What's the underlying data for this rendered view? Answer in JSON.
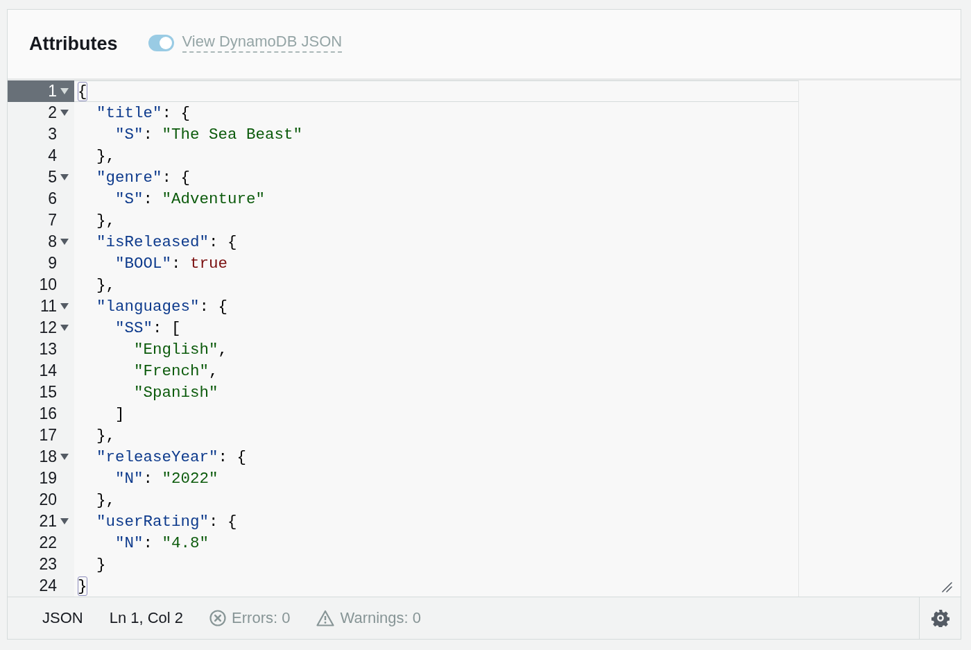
{
  "header": {
    "title": "Attributes",
    "toggle": {
      "label": "View DynamoDB JSON",
      "on": true,
      "disabled": true
    }
  },
  "editor": {
    "lines": [
      {
        "number": "1",
        "fold": true,
        "active": true,
        "bracket_match": true,
        "tokens": [
          {
            "kind": "punct",
            "text": "{"
          }
        ]
      },
      {
        "number": "2",
        "fold": true,
        "active": false,
        "bracket_match": false,
        "tokens": [
          {
            "kind": "key",
            "text": "\"title\""
          },
          {
            "kind": "punct",
            "text": ": {"
          }
        ]
      },
      {
        "number": "3",
        "fold": false,
        "active": false,
        "bracket_match": false,
        "tokens": [
          {
            "kind": "key",
            "text": "\"S\""
          },
          {
            "kind": "punct",
            "text": ": "
          },
          {
            "kind": "string",
            "text": "\"The Sea Beast\""
          }
        ]
      },
      {
        "number": "4",
        "fold": false,
        "active": false,
        "bracket_match": false,
        "tokens": [
          {
            "kind": "punct",
            "text": "},"
          }
        ]
      },
      {
        "number": "5",
        "fold": true,
        "active": false,
        "bracket_match": false,
        "tokens": [
          {
            "kind": "key",
            "text": "\"genre\""
          },
          {
            "kind": "punct",
            "text": ": {"
          }
        ]
      },
      {
        "number": "6",
        "fold": false,
        "active": false,
        "bracket_match": false,
        "tokens": [
          {
            "kind": "key",
            "text": "\"S\""
          },
          {
            "kind": "punct",
            "text": ": "
          },
          {
            "kind": "string",
            "text": "\"Adventure\""
          }
        ]
      },
      {
        "number": "7",
        "fold": false,
        "active": false,
        "bracket_match": false,
        "tokens": [
          {
            "kind": "punct",
            "text": "},"
          }
        ]
      },
      {
        "number": "8",
        "fold": true,
        "active": false,
        "bracket_match": false,
        "tokens": [
          {
            "kind": "key",
            "text": "\"isReleased\""
          },
          {
            "kind": "punct",
            "text": ": {"
          }
        ]
      },
      {
        "number": "9",
        "fold": false,
        "active": false,
        "bracket_match": false,
        "tokens": [
          {
            "kind": "key",
            "text": "\"BOOL\""
          },
          {
            "kind": "punct",
            "text": ": "
          },
          {
            "kind": "bool",
            "text": "true"
          }
        ]
      },
      {
        "number": "10",
        "fold": false,
        "active": false,
        "bracket_match": false,
        "tokens": [
          {
            "kind": "punct",
            "text": "},"
          }
        ]
      },
      {
        "number": "11",
        "fold": true,
        "active": false,
        "bracket_match": false,
        "tokens": [
          {
            "kind": "key",
            "text": "\"languages\""
          },
          {
            "kind": "punct",
            "text": ": {"
          }
        ]
      },
      {
        "number": "12",
        "fold": true,
        "active": false,
        "bracket_match": false,
        "tokens": [
          {
            "kind": "key",
            "text": "\"SS\""
          },
          {
            "kind": "punct",
            "text": ": ["
          }
        ]
      },
      {
        "number": "13",
        "fold": false,
        "active": false,
        "bracket_match": false,
        "tokens": [
          {
            "kind": "string",
            "text": "\"English\""
          },
          {
            "kind": "punct",
            "text": ","
          }
        ]
      },
      {
        "number": "14",
        "fold": false,
        "active": false,
        "bracket_match": false,
        "tokens": [
          {
            "kind": "string",
            "text": "\"French\""
          },
          {
            "kind": "punct",
            "text": ","
          }
        ]
      },
      {
        "number": "15",
        "fold": false,
        "active": false,
        "bracket_match": false,
        "tokens": [
          {
            "kind": "string",
            "text": "\"Spanish\""
          }
        ]
      },
      {
        "number": "16",
        "fold": false,
        "active": false,
        "bracket_match": false,
        "tokens": [
          {
            "kind": "punct",
            "text": "]"
          }
        ]
      },
      {
        "number": "17",
        "fold": false,
        "active": false,
        "bracket_match": false,
        "tokens": [
          {
            "kind": "punct",
            "text": "},"
          }
        ]
      },
      {
        "number": "18",
        "fold": true,
        "active": false,
        "bracket_match": false,
        "tokens": [
          {
            "kind": "key",
            "text": "\"releaseYear\""
          },
          {
            "kind": "punct",
            "text": ": {"
          }
        ]
      },
      {
        "number": "19",
        "fold": false,
        "active": false,
        "bracket_match": false,
        "tokens": [
          {
            "kind": "key",
            "text": "\"N\""
          },
          {
            "kind": "punct",
            "text": ": "
          },
          {
            "kind": "string",
            "text": "\"2022\""
          }
        ]
      },
      {
        "number": "20",
        "fold": false,
        "active": false,
        "bracket_match": false,
        "tokens": [
          {
            "kind": "punct",
            "text": "},"
          }
        ]
      },
      {
        "number": "21",
        "fold": true,
        "active": false,
        "bracket_match": false,
        "tokens": [
          {
            "kind": "key",
            "text": "\"userRating\""
          },
          {
            "kind": "punct",
            "text": ": {"
          }
        ]
      },
      {
        "number": "22",
        "fold": false,
        "active": false,
        "bracket_match": false,
        "tokens": [
          {
            "kind": "key",
            "text": "\"N\""
          },
          {
            "kind": "punct",
            "text": ": "
          },
          {
            "kind": "string",
            "text": "\"4.8\""
          }
        ]
      },
      {
        "number": "23",
        "fold": false,
        "active": false,
        "bracket_match": false,
        "tokens": [
          {
            "kind": "punct",
            "text": "}"
          }
        ]
      },
      {
        "number": "24",
        "fold": false,
        "active": false,
        "bracket_match": true,
        "tokens": [
          {
            "kind": "punct",
            "text": "}"
          }
        ]
      }
    ]
  },
  "status_bar": {
    "language": "JSON",
    "position": "Ln 1, Col 2",
    "errors": "Errors: 0",
    "warnings": "Warnings: 0"
  }
}
